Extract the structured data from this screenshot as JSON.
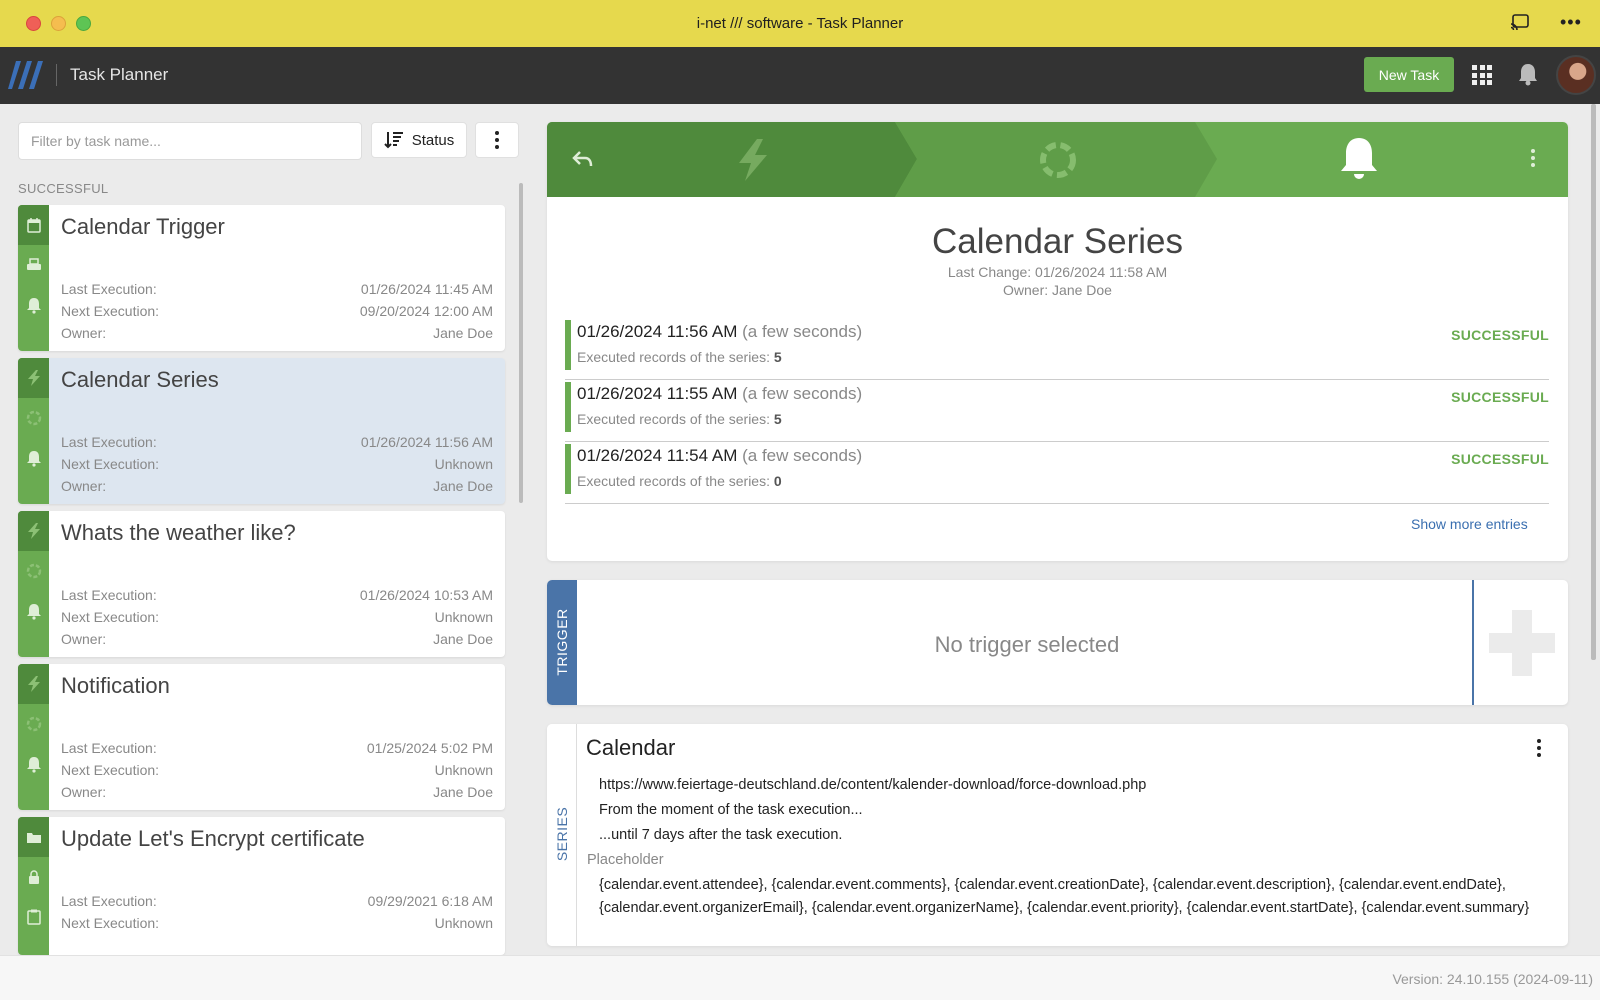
{
  "window": {
    "title": "i-net /// software - Task Planner"
  },
  "appbar": {
    "title": "Task Planner",
    "new_task_label": "New Task"
  },
  "sidebar": {
    "filter_placeholder": "Filter by task name...",
    "sort_label": "Status",
    "section_label": "SUCCESSFUL",
    "labels": {
      "last": "Last Execution:",
      "next": "Next Execution:",
      "owner": "Owner:"
    },
    "tasks": [
      {
        "title": "Calendar Trigger",
        "last": "01/26/2024 11:45 AM",
        "next": "09/20/2024 12:00 AM",
        "owner": "Jane Doe",
        "icons": [
          "calendar-icon",
          "printer-icon",
          "bell-icon"
        ],
        "selected": false
      },
      {
        "title": "Calendar Series",
        "last": "01/26/2024 11:56 AM",
        "next": "Unknown",
        "owner": "Jane Doe",
        "icons": [
          "bolt-icon",
          "ring-icon",
          "bell-icon"
        ],
        "selected": true
      },
      {
        "title": "Whats the weather like?",
        "last": "01/26/2024 10:53 AM",
        "next": "Unknown",
        "owner": "Jane Doe",
        "icons": [
          "bolt-icon",
          "ring-icon",
          "bell-icon"
        ],
        "selected": false
      },
      {
        "title": "Notification",
        "last": "01/25/2024 5:02 PM",
        "next": "Unknown",
        "owner": "Jane Doe",
        "icons": [
          "bolt-icon",
          "ring-icon",
          "bell-icon"
        ],
        "selected": false
      },
      {
        "title": "Update Let's Encrypt certificate",
        "last": "09/29/2021 6:18 AM",
        "next": "Unknown",
        "owner": "",
        "icons": [
          "folder-icon",
          "lock-icon",
          "clipboard-icon"
        ],
        "selected": false
      }
    ]
  },
  "detail": {
    "title": "Calendar Series",
    "last_change": "Last Change: 01/26/2024 11:58 AM",
    "owner": "Owner: Jane Doe",
    "records_label": "Executed records of the series:",
    "executions": [
      {
        "time": "01/26/2024 11:56 AM",
        "relative": "(a few seconds)",
        "records": "5",
        "status": "SUCCESSFUL"
      },
      {
        "time": "01/26/2024 11:55 AM",
        "relative": "(a few seconds)",
        "records": "5",
        "status": "SUCCESSFUL"
      },
      {
        "time": "01/26/2024 11:54 AM",
        "relative": "(a few seconds)",
        "records": "0",
        "status": "SUCCESSFUL"
      }
    ],
    "show_more": "Show more entries"
  },
  "trigger": {
    "tab_label": "TRIGGER",
    "empty_text": "No trigger selected"
  },
  "series": {
    "tab_label": "SERIES",
    "title": "Calendar",
    "url": "https://www.feiertage-deutschland.de/content/kalender-download/force-download.php",
    "from": "From the moment of the task execution...",
    "until": "...until 7 days after the task execution.",
    "placeholder_label": "Placeholder",
    "placeholders": "{calendar.event.attendee}, {calendar.event.comments}, {calendar.event.creationDate}, {calendar.event.description}, {calendar.event.endDate}, {calendar.event.organizerEmail}, {calendar.event.organizerName}, {calendar.event.priority}, {calendar.event.startDate}, {calendar.event.sum­mary}"
  },
  "footer": {
    "version": "Version: 24.10.155 (2024-09-11)"
  },
  "colors": {
    "titlebar": "#e6d94d",
    "appbar": "#333333",
    "accent_green": "#6aab51",
    "dark_green": "#4f8a3c",
    "trigger_blue": "#4a74a8",
    "selected_card": "#dde6f0"
  }
}
